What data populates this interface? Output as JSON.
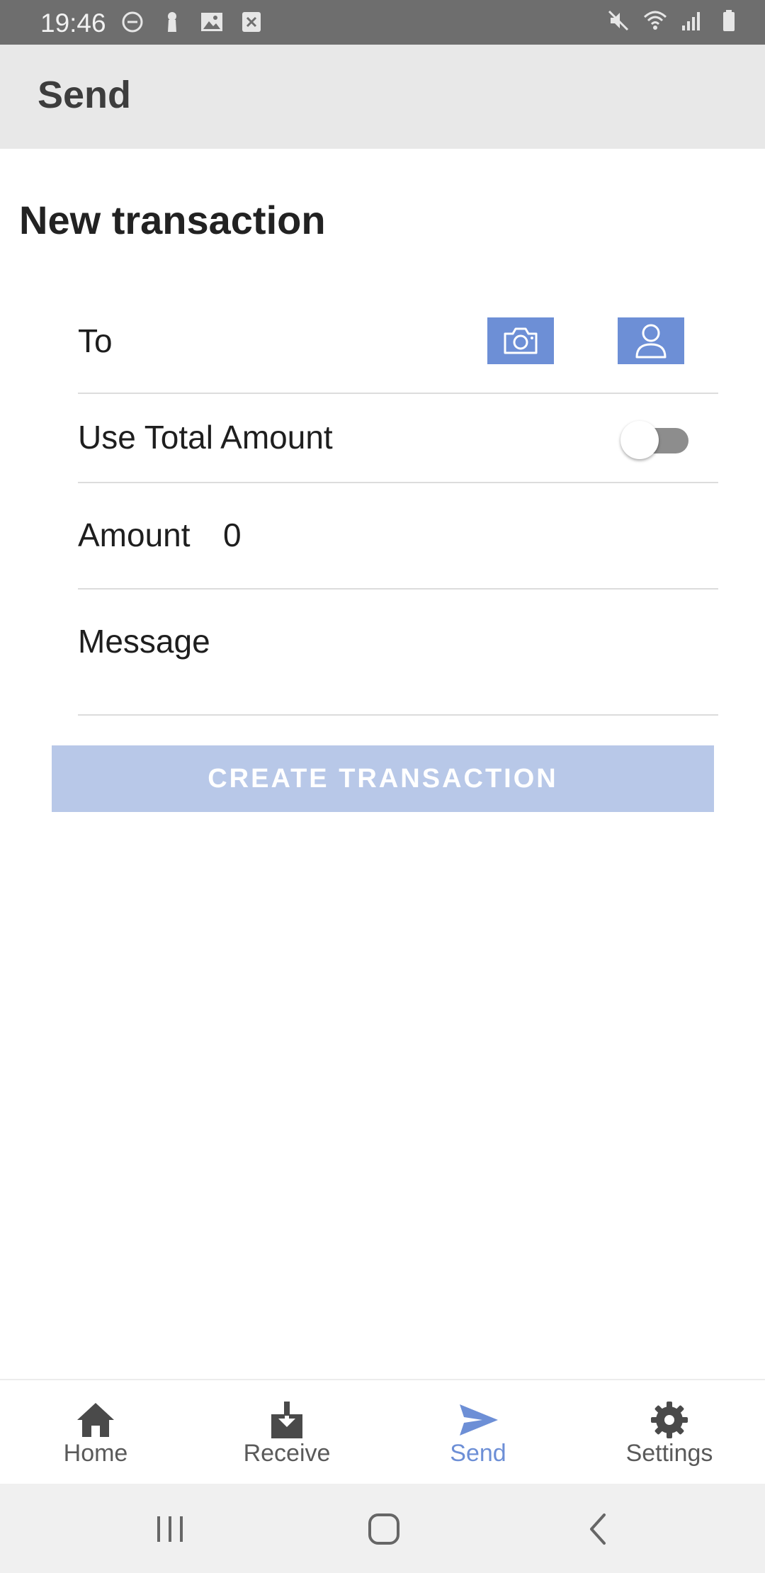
{
  "status_bar": {
    "time": "19:46",
    "left_icons": [
      "do-not-disturb-icon",
      "keyhole-icon",
      "gallery-icon",
      "close-box-icon"
    ],
    "right_icons": [
      "mute-icon",
      "wifi-icon",
      "signal-icon",
      "battery-icon"
    ]
  },
  "app_bar": {
    "title": "Send"
  },
  "form": {
    "section_title": "New transaction",
    "to_label": "To",
    "use_total_label": "Use Total Amount",
    "use_total_enabled": false,
    "amount_label": "Amount",
    "amount_value": "0",
    "message_label": "Message",
    "submit_label": "CREATE TRANSACTION"
  },
  "bottom_nav": {
    "items": [
      {
        "label": "Home",
        "icon": "home-icon",
        "active": false
      },
      {
        "label": "Receive",
        "icon": "download-icon",
        "active": false
      },
      {
        "label": "Send",
        "icon": "send-icon",
        "active": true
      },
      {
        "label": "Settings",
        "icon": "gear-icon",
        "active": false
      }
    ]
  },
  "colors": {
    "accent": "#6d8fd6",
    "button_disabled": "#b8c8e8",
    "app_bar_bg": "#e8e8e8",
    "status_bar_bg": "#6e6e6e"
  }
}
